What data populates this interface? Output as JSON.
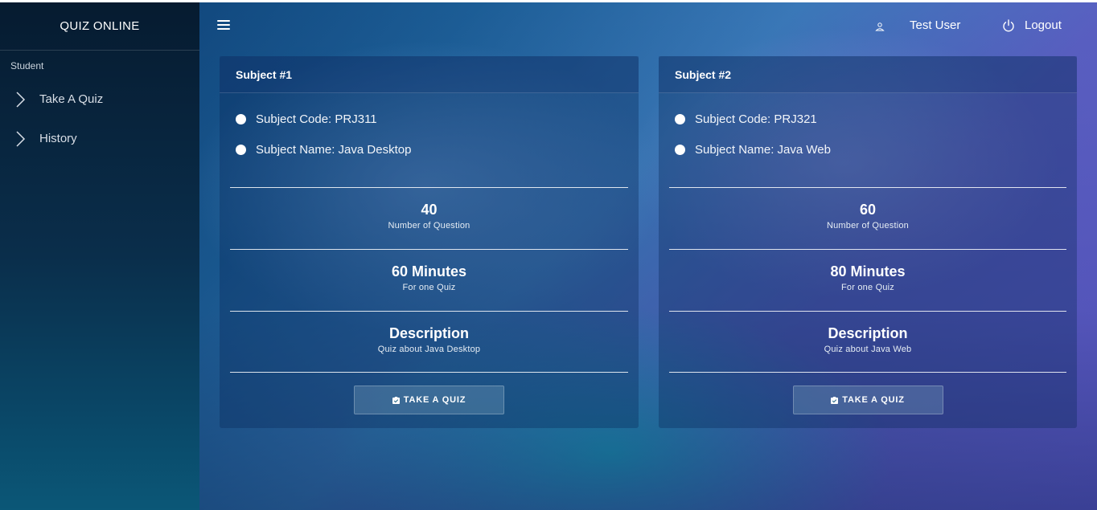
{
  "app": {
    "brand": "QUIZ ONLINE"
  },
  "sidebar": {
    "section_label": "Student",
    "items": [
      {
        "label": "Take A Quiz",
        "icon": "chevron-right-icon"
      },
      {
        "label": "History",
        "icon": "chevron-right-icon"
      }
    ]
  },
  "topbar": {
    "menu_icon": "hamburger-menu-icon",
    "user_name": "Test User",
    "user_icon": "user-icon",
    "logout_label": "Logout",
    "logout_icon": "power-icon"
  },
  "subjects": [
    {
      "header": "Subject #1",
      "code_line": "Subject Code: PRJ311",
      "name_line": "Subject Name: Java Desktop",
      "questions_value": "40",
      "questions_label": "Number of Question",
      "duration_value": "60 Minutes",
      "duration_label": "For one Quiz",
      "description_title": "Description",
      "description_text": "Quiz about Java Desktop",
      "button_label": "TAKE A QUIZ"
    },
    {
      "header": "Subject #2",
      "code_line": "Subject Code: PRJ321",
      "name_line": "Subject Name: Java Web",
      "questions_value": "60",
      "questions_label": "Number of Question",
      "duration_value": "80 Minutes",
      "duration_label": "For one Quiz",
      "description_title": "Description",
      "description_text": "Quiz about Java Web",
      "button_label": "TAKE A QUIZ"
    }
  ],
  "colors": {
    "sidebar_top": "#061b30",
    "accent_purple": "#6a5cd6",
    "accent_teal": "#14aabe"
  }
}
